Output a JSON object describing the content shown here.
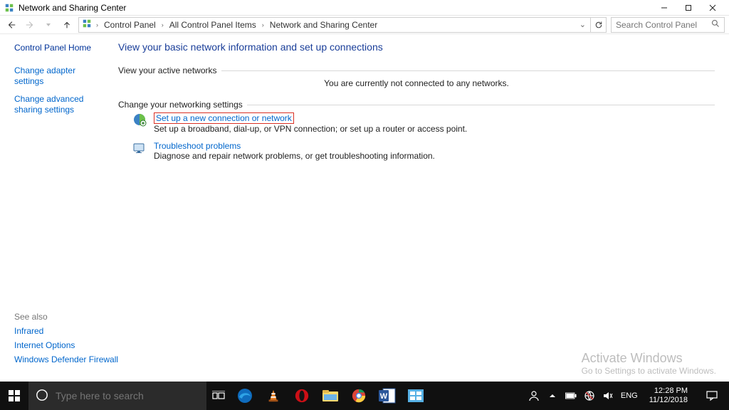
{
  "window": {
    "title": "Network and Sharing Center"
  },
  "breadcrumb": {
    "a": "Control Panel",
    "b": "All Control Panel Items",
    "c": "Network and Sharing Center"
  },
  "search": {
    "placeholder": "Search Control Panel"
  },
  "sidebar": {
    "home": "Control Panel Home",
    "links": {
      "adapter": "Change adapter settings",
      "advanced": "Change advanced sharing settings"
    }
  },
  "seealso": {
    "hdr": "See also",
    "a": "Infrared",
    "b": "Internet Options",
    "c": "Windows Defender Firewall"
  },
  "main": {
    "heading": "View your basic network information and set up connections",
    "sec1": "View your active networks",
    "no_net": "You are currently not connected to any networks.",
    "sec2": "Change your networking settings",
    "task1": {
      "link": "Set up a new connection or network",
      "desc": "Set up a broadband, dial-up, or VPN connection; or set up a router or access point."
    },
    "task2": {
      "link": "Troubleshoot problems",
      "desc": "Diagnose and repair network problems, or get troubleshooting information."
    }
  },
  "activate": {
    "a": "Activate Windows",
    "b": "Go to Settings to activate Windows."
  },
  "taskbar": {
    "search_placeholder": "Type here to search",
    "lang": "ENG",
    "time": "12:28 PM",
    "date": "11/12/2018"
  }
}
